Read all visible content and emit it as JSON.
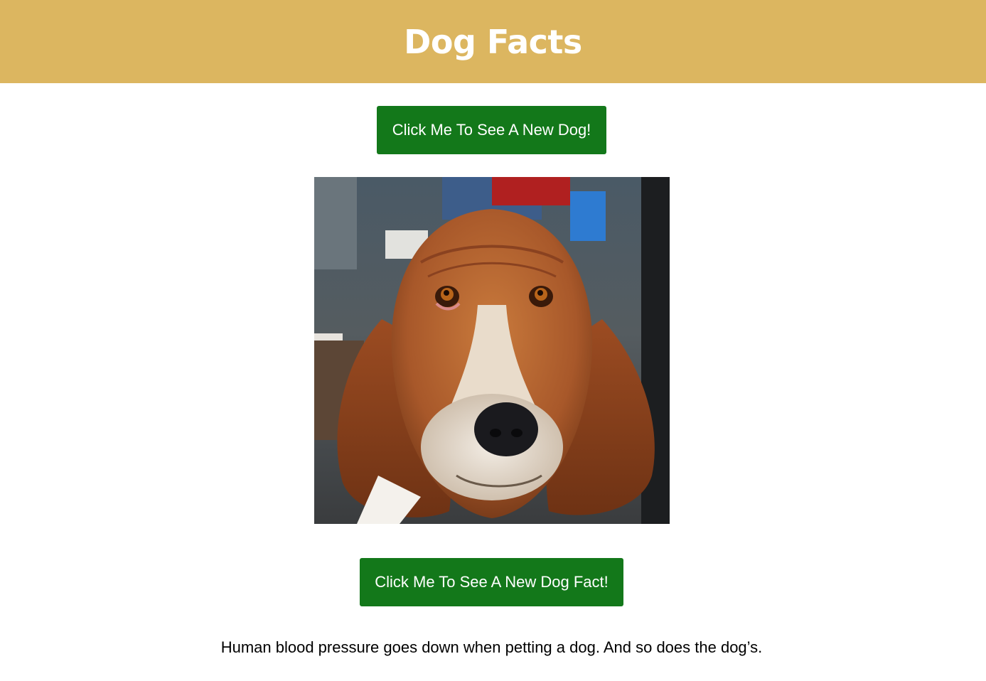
{
  "header": {
    "title": "Dog Facts",
    "background": "#dcb660"
  },
  "buttons": {
    "new_dog_label": "Click Me To See A New Dog!",
    "new_fact_label": "Click Me To See A New Dog Fact!",
    "color": "#13781a"
  },
  "dog_image": {
    "icon": "basset-hound-photo"
  },
  "fact": {
    "text": "Human blood pressure goes down when petting a dog. And so does the dog’s."
  }
}
